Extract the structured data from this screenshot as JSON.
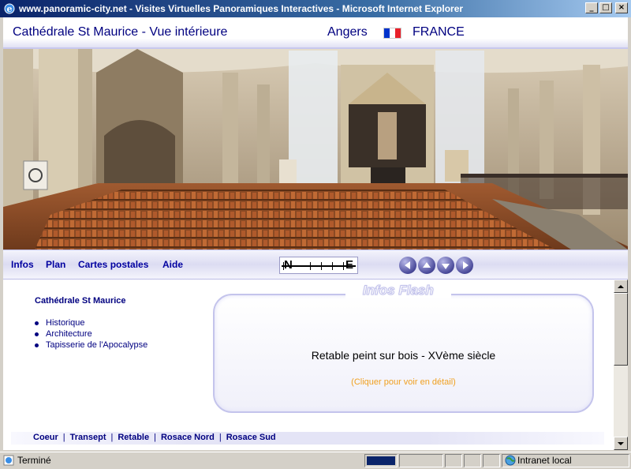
{
  "window": {
    "title": "www.panoramic-city.net - Visites Virtuelles Panoramiques Interactives - Microsoft Internet Explorer",
    "minimize": "_",
    "maximize": "□",
    "close": "×"
  },
  "header": {
    "title": "Cathédrale St Maurice - Vue intérieure",
    "city": "Angers",
    "country": "FRANCE",
    "flag_colors": [
      "#0033cc",
      "#ffffff",
      "#e8202a"
    ]
  },
  "nav": {
    "items": [
      {
        "label": "Infos"
      },
      {
        "label": "Plan"
      },
      {
        "label": "Cartes postales"
      },
      {
        "label": "Aide"
      }
    ],
    "compass_left": "N",
    "compass_right": "E",
    "arrows": [
      "arrow-left-icon",
      "arrow-up-icon",
      "arrow-down-icon",
      "arrow-right-icon"
    ]
  },
  "sidebar": {
    "title": "Cathédrale St Maurice",
    "items": [
      {
        "label": "Historique"
      },
      {
        "label": "Architecture"
      },
      {
        "label": "Tapisserie de l'Apocalypse"
      }
    ]
  },
  "flash": {
    "label": "Infos Flash",
    "main_text": "Retable peint sur bois - XVème siècle",
    "link_text": "(Cliquer pour voir en détail)"
  },
  "bottom_links": {
    "items": [
      {
        "label": "Coeur"
      },
      {
        "label": "Transept"
      },
      {
        "label": "Retable"
      },
      {
        "label": "Rosace Nord"
      },
      {
        "label": "Rosace Sud"
      }
    ],
    "separator": "|"
  },
  "status": {
    "text": "Terminé",
    "zone": "Intranet local"
  },
  "colors": {
    "link_blue": "#000080",
    "accent_orange": "#f0a020",
    "nav_border": "#c4c4ec"
  }
}
